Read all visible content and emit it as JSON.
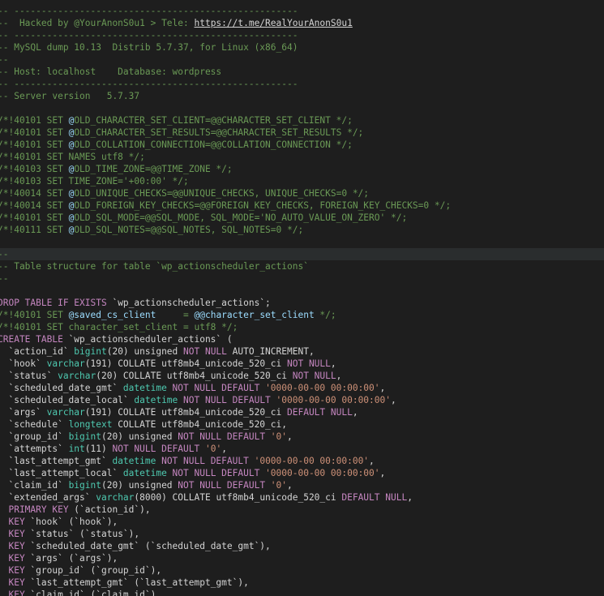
{
  "editor": {
    "colors": {
      "background": "#1e1e1e",
      "highlight": "#2a2d2e",
      "comment": "#6a9955",
      "keyword": "#c586c0",
      "type": "#4ec9b0",
      "string": "#ce9178",
      "variable": "#9cdcfe",
      "plain": "#d4d4d4"
    },
    "lines": [
      {
        "tokens": [
          {
            "t": "comment",
            "v": "-- ----------------------------------------------------"
          }
        ]
      },
      {
        "tokens": [
          {
            "t": "comment",
            "v": "--  Hacked by @YourAnonS0u1 > Tele: "
          },
          {
            "t": "link",
            "v": "https://t.me/RealYourAnonS0u1"
          }
        ]
      },
      {
        "tokens": [
          {
            "t": "comment",
            "v": "-- ----------------------------------------------------"
          }
        ]
      },
      {
        "tokens": [
          {
            "t": "comment",
            "v": "-- MySQL dump 10.13  Distrib 5.7.37, for Linux (x86_64)"
          }
        ]
      },
      {
        "tokens": [
          {
            "t": "comment",
            "v": "--"
          }
        ]
      },
      {
        "tokens": [
          {
            "t": "comment",
            "v": "-- Host: localhost    Database: wordpress"
          }
        ]
      },
      {
        "tokens": [
          {
            "t": "comment",
            "v": "-- ----------------------------------------------------"
          }
        ]
      },
      {
        "tokens": [
          {
            "t": "comment",
            "v": "-- Server version   5.7.37"
          }
        ]
      },
      {
        "tokens": []
      },
      {
        "tokens": [
          {
            "t": "comment",
            "v": "/*!40101 SET "
          },
          {
            "t": "var",
            "v": "@"
          },
          {
            "t": "comment",
            "v": "OLD_CHARACTER_SET_CLIENT=@@CHARACTER_SET_CLIENT */;"
          }
        ]
      },
      {
        "tokens": [
          {
            "t": "comment",
            "v": "/*!40101 SET "
          },
          {
            "t": "var",
            "v": "@"
          },
          {
            "t": "comment",
            "v": "OLD_CHARACTER_SET_RESULTS=@@CHARACTER_SET_RESULTS */;"
          }
        ]
      },
      {
        "tokens": [
          {
            "t": "comment",
            "v": "/*!40101 SET "
          },
          {
            "t": "var",
            "v": "@"
          },
          {
            "t": "comment",
            "v": "OLD_COLLATION_CONNECTION=@@COLLATION_CONNECTION */;"
          }
        ]
      },
      {
        "tokens": [
          {
            "t": "comment",
            "v": "/*!40101 SET NAMES utf8 */;"
          }
        ]
      },
      {
        "tokens": [
          {
            "t": "comment",
            "v": "/*!40103 SET "
          },
          {
            "t": "var",
            "v": "@"
          },
          {
            "t": "comment",
            "v": "OLD_TIME_ZONE=@@TIME_ZONE */;"
          }
        ]
      },
      {
        "tokens": [
          {
            "t": "comment",
            "v": "/*!40103 SET TIME_ZONE='+00:00' */;"
          }
        ]
      },
      {
        "tokens": [
          {
            "t": "comment",
            "v": "/*!40014 SET "
          },
          {
            "t": "var",
            "v": "@"
          },
          {
            "t": "comment",
            "v": "OLD_UNIQUE_CHECKS=@@UNIQUE_CHECKS, UNIQUE_CHECKS=0 */;"
          }
        ]
      },
      {
        "tokens": [
          {
            "t": "comment",
            "v": "/*!40014 SET "
          },
          {
            "t": "var",
            "v": "@"
          },
          {
            "t": "comment",
            "v": "OLD_FOREIGN_KEY_CHECKS=@@FOREIGN_KEY_CHECKS, FOREIGN_KEY_CHECKS=0 */;"
          }
        ]
      },
      {
        "tokens": [
          {
            "t": "comment",
            "v": "/*!40101 SET "
          },
          {
            "t": "var",
            "v": "@"
          },
          {
            "t": "comment",
            "v": "OLD_SQL_MODE=@@SQL_MODE, SQL_MODE='NO_AUTO_VALUE_ON_ZERO' */;"
          }
        ]
      },
      {
        "tokens": [
          {
            "t": "comment",
            "v": "/*!40111 SET "
          },
          {
            "t": "var",
            "v": "@"
          },
          {
            "t": "comment",
            "v": "OLD_SQL_NOTES=@@SQL_NOTES, SQL_NOTES=0 */;"
          }
        ]
      },
      {
        "tokens": []
      },
      {
        "hl": true,
        "tokens": [
          {
            "t": "comment",
            "v": "--"
          }
        ]
      },
      {
        "tokens": [
          {
            "t": "comment",
            "v": "-- Table structure for table `wp_actionscheduler_actions`"
          }
        ]
      },
      {
        "tokens": [
          {
            "t": "comment",
            "v": "--"
          }
        ]
      },
      {
        "tokens": []
      },
      {
        "tokens": [
          {
            "t": "keyword",
            "v": "DROP TABLE IF EXISTS "
          },
          {
            "t": "ident",
            "v": "`wp_actionscheduler_actions`"
          },
          {
            "t": "plain",
            "v": ";"
          }
        ]
      },
      {
        "tokens": [
          {
            "t": "comment",
            "v": "/*!40101 SET "
          },
          {
            "t": "var",
            "v": "@saved_cs_client"
          },
          {
            "t": "comment",
            "v": "     = "
          },
          {
            "t": "var",
            "v": "@@character_set_client"
          },
          {
            "t": "comment",
            "v": " */;"
          }
        ]
      },
      {
        "tokens": [
          {
            "t": "comment",
            "v": "/*!40101 SET character_set_client = utf8 */;"
          }
        ]
      },
      {
        "tokens": [
          {
            "t": "keyword",
            "v": "CREATE TABLE "
          },
          {
            "t": "ident",
            "v": "`wp_actionscheduler_actions`"
          },
          {
            "t": "plain",
            "v": " ("
          }
        ]
      },
      {
        "tokens": [
          {
            "t": "ident",
            "v": "  `action_id` "
          },
          {
            "t": "type",
            "v": "bigint"
          },
          {
            "t": "plain",
            "v": "(20) unsigned "
          },
          {
            "t": "keyword",
            "v": "NOT NULL"
          },
          {
            "t": "plain",
            "v": " AUTO_INCREMENT,"
          }
        ]
      },
      {
        "tokens": [
          {
            "t": "ident",
            "v": "  `hook` "
          },
          {
            "t": "type",
            "v": "varchar"
          },
          {
            "t": "plain",
            "v": "(191) COLLATE utf8mb4_unicode_520_ci "
          },
          {
            "t": "keyword",
            "v": "NOT NULL"
          },
          {
            "t": "plain",
            "v": ","
          }
        ]
      },
      {
        "tokens": [
          {
            "t": "ident",
            "v": "  `status` "
          },
          {
            "t": "type",
            "v": "varchar"
          },
          {
            "t": "plain",
            "v": "(20) COLLATE utf8mb4_unicode_520_ci "
          },
          {
            "t": "keyword",
            "v": "NOT NULL"
          },
          {
            "t": "plain",
            "v": ","
          }
        ]
      },
      {
        "tokens": [
          {
            "t": "ident",
            "v": "  `scheduled_date_gmt` "
          },
          {
            "t": "type",
            "v": "datetime"
          },
          {
            "t": "keyword",
            "v": " NOT NULL DEFAULT "
          },
          {
            "t": "string",
            "v": "'0000-00-00 00:00:00'"
          },
          {
            "t": "plain",
            "v": ","
          }
        ]
      },
      {
        "tokens": [
          {
            "t": "ident",
            "v": "  `scheduled_date_local` "
          },
          {
            "t": "type",
            "v": "datetime"
          },
          {
            "t": "keyword",
            "v": " NOT NULL DEFAULT "
          },
          {
            "t": "string",
            "v": "'0000-00-00 00:00:00'"
          },
          {
            "t": "plain",
            "v": ","
          }
        ]
      },
      {
        "tokens": [
          {
            "t": "ident",
            "v": "  `args` "
          },
          {
            "t": "type",
            "v": "varchar"
          },
          {
            "t": "plain",
            "v": "(191) COLLATE utf8mb4_unicode_520_ci "
          },
          {
            "t": "keyword",
            "v": "DEFAULT NULL"
          },
          {
            "t": "plain",
            "v": ","
          }
        ]
      },
      {
        "tokens": [
          {
            "t": "ident",
            "v": "  `schedule` "
          },
          {
            "t": "type",
            "v": "longtext"
          },
          {
            "t": "plain",
            "v": " COLLATE utf8mb4_unicode_520_ci,"
          }
        ]
      },
      {
        "tokens": [
          {
            "t": "ident",
            "v": "  `group_id` "
          },
          {
            "t": "type",
            "v": "bigint"
          },
          {
            "t": "plain",
            "v": "(20) unsigned "
          },
          {
            "t": "keyword",
            "v": "NOT NULL DEFAULT "
          },
          {
            "t": "string",
            "v": "'0'"
          },
          {
            "t": "plain",
            "v": ","
          }
        ]
      },
      {
        "tokens": [
          {
            "t": "ident",
            "v": "  `attempts` "
          },
          {
            "t": "type",
            "v": "int"
          },
          {
            "t": "plain",
            "v": "(11) "
          },
          {
            "t": "keyword",
            "v": "NOT NULL DEFAULT "
          },
          {
            "t": "string",
            "v": "'0'"
          },
          {
            "t": "plain",
            "v": ","
          }
        ]
      },
      {
        "tokens": [
          {
            "t": "ident",
            "v": "  `last_attempt_gmt` "
          },
          {
            "t": "type",
            "v": "datetime"
          },
          {
            "t": "keyword",
            "v": " NOT NULL DEFAULT "
          },
          {
            "t": "string",
            "v": "'0000-00-00 00:00:00'"
          },
          {
            "t": "plain",
            "v": ","
          }
        ]
      },
      {
        "tokens": [
          {
            "t": "ident",
            "v": "  `last_attempt_local` "
          },
          {
            "t": "type",
            "v": "datetime"
          },
          {
            "t": "keyword",
            "v": " NOT NULL DEFAULT "
          },
          {
            "t": "string",
            "v": "'0000-00-00 00:00:00'"
          },
          {
            "t": "plain",
            "v": ","
          }
        ]
      },
      {
        "tokens": [
          {
            "t": "ident",
            "v": "  `claim_id` "
          },
          {
            "t": "type",
            "v": "bigint"
          },
          {
            "t": "plain",
            "v": "(20) unsigned "
          },
          {
            "t": "keyword",
            "v": "NOT NULL DEFAULT "
          },
          {
            "t": "string",
            "v": "'0'"
          },
          {
            "t": "plain",
            "v": ","
          }
        ]
      },
      {
        "tokens": [
          {
            "t": "ident",
            "v": "  `extended_args` "
          },
          {
            "t": "type",
            "v": "varchar"
          },
          {
            "t": "plain",
            "v": "(8000) COLLATE utf8mb4_unicode_520_ci "
          },
          {
            "t": "keyword",
            "v": "DEFAULT NULL"
          },
          {
            "t": "plain",
            "v": ","
          }
        ]
      },
      {
        "tokens": [
          {
            "t": "keyword",
            "v": "  PRIMARY KEY "
          },
          {
            "t": "ident",
            "v": "(`action_id`)"
          },
          {
            "t": "plain",
            "v": ","
          }
        ]
      },
      {
        "tokens": [
          {
            "t": "keyword",
            "v": "  KEY "
          },
          {
            "t": "ident",
            "v": "`hook` (`hook`)"
          },
          {
            "t": "plain",
            "v": ","
          }
        ]
      },
      {
        "tokens": [
          {
            "t": "keyword",
            "v": "  KEY "
          },
          {
            "t": "ident",
            "v": "`status` (`status`)"
          },
          {
            "t": "plain",
            "v": ","
          }
        ]
      },
      {
        "tokens": [
          {
            "t": "keyword",
            "v": "  KEY "
          },
          {
            "t": "ident",
            "v": "`scheduled_date_gmt` (`scheduled_date_gmt`)"
          },
          {
            "t": "plain",
            "v": ","
          }
        ]
      },
      {
        "tokens": [
          {
            "t": "keyword",
            "v": "  KEY "
          },
          {
            "t": "ident",
            "v": "`args` (`args`)"
          },
          {
            "t": "plain",
            "v": ","
          }
        ]
      },
      {
        "tokens": [
          {
            "t": "keyword",
            "v": "  KEY "
          },
          {
            "t": "ident",
            "v": "`group_id` (`group_id`)"
          },
          {
            "t": "plain",
            "v": ","
          }
        ]
      },
      {
        "tokens": [
          {
            "t": "keyword",
            "v": "  KEY "
          },
          {
            "t": "ident",
            "v": "`last_attempt_gmt` (`last_attempt_gmt`)"
          },
          {
            "t": "plain",
            "v": ","
          }
        ]
      },
      {
        "tokens": [
          {
            "t": "keyword",
            "v": "  KEY "
          },
          {
            "t": "ident",
            "v": "`claim_id` (`claim_id`)"
          },
          {
            "t": "plain",
            "v": ","
          }
        ]
      }
    ]
  }
}
